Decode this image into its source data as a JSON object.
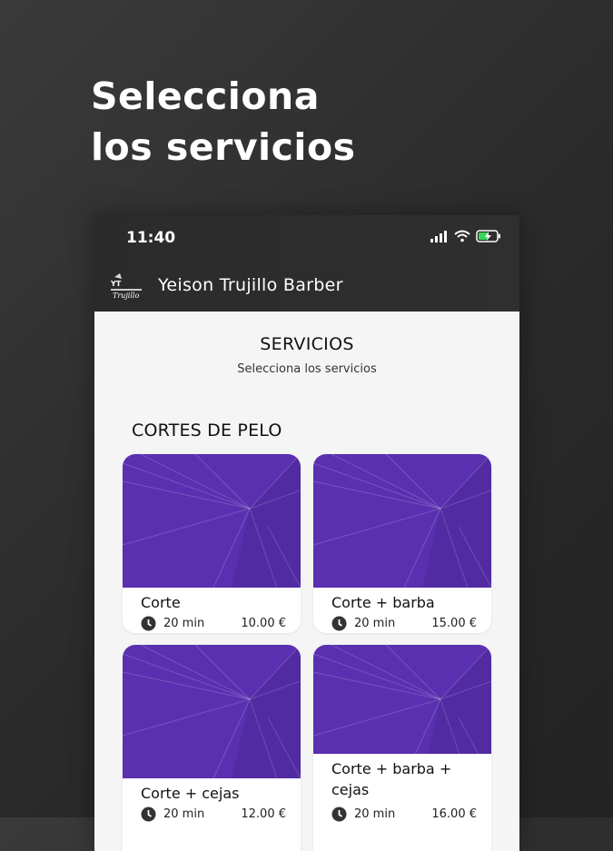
{
  "headline": {
    "line1": "Selecciona",
    "line2": "los servicios"
  },
  "status_bar": {
    "time": "11:40"
  },
  "app_bar": {
    "title": "Yeison Trujillo Barber",
    "logo_text": "Yeison Trujillo"
  },
  "page": {
    "title": "SERVICIOS",
    "subtitle": "Selecciona los servicios"
  },
  "section": {
    "title": "CORTES DE PELO"
  },
  "services": [
    {
      "name": "Corte",
      "duration": "20 min",
      "price": "10.00 €"
    },
    {
      "name": "Corte + barba",
      "duration": "20 min",
      "price": "15.00 €"
    },
    {
      "name": "Corte + cejas",
      "duration": "20 min",
      "price": "12.00 €"
    },
    {
      "name": "Corte + barba + cejas",
      "duration": "20 min",
      "price": "16.00 €"
    }
  ],
  "colors": {
    "card_image": "#5a2fb0",
    "background": "#2d2d2d",
    "content": "#f5f5f5"
  }
}
